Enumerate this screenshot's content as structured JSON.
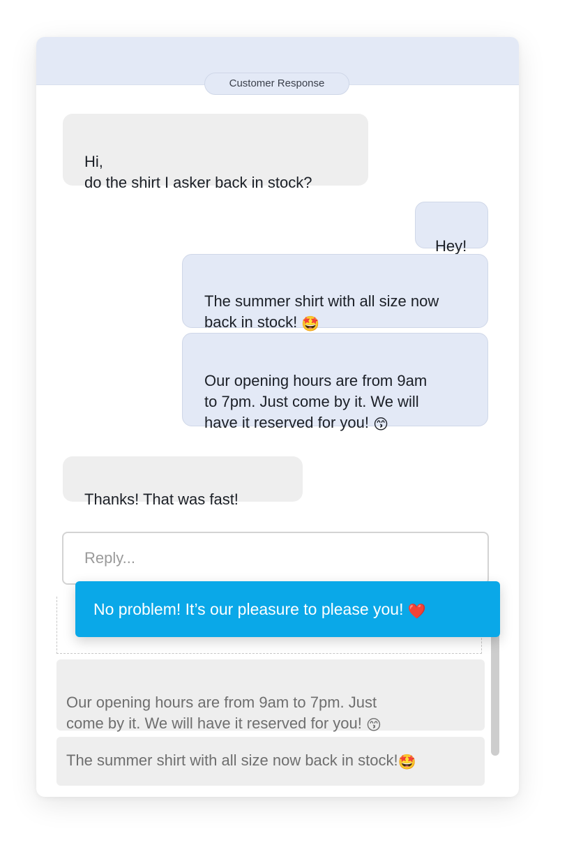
{
  "header": {
    "label": "Customer Response"
  },
  "messages": [
    {
      "direction": "incoming",
      "text": "Hi,\ndo the shirt I asker back in stock?"
    },
    {
      "direction": "outgoing",
      "text": "Hey!"
    },
    {
      "direction": "outgoing",
      "text": "The summer shirt with all size now\nback in stock! ",
      "emoji": "🤩"
    },
    {
      "direction": "outgoing",
      "text": "Our opening hours are from 9am\nto 7pm. Just come by it. We will\nhave it reserved for you! ",
      "emoji": "😙"
    },
    {
      "direction": "incoming",
      "text": "Thanks! That was fast!"
    }
  ],
  "reply": {
    "placeholder": "Reply...",
    "value": ""
  },
  "suggestions": {
    "active": {
      "text": "No problem! It’s our pleasure to please you! ",
      "emoji": "❤️"
    },
    "items": [
      {
        "text": "Our opening hours are from 9am to 7pm. Just\ncome by it. We will have it reserved for you! ",
        "emoji": "😙"
      },
      {
        "text": "The summer shirt with all size now back in stock!",
        "emoji": "🤩"
      }
    ]
  },
  "colors": {
    "header_bg": "#e3e9f6",
    "incoming_bg": "#eeeeee",
    "outgoing_bg": "#e3e9f6",
    "active_suggestion_bg": "#0aa8e8"
  }
}
